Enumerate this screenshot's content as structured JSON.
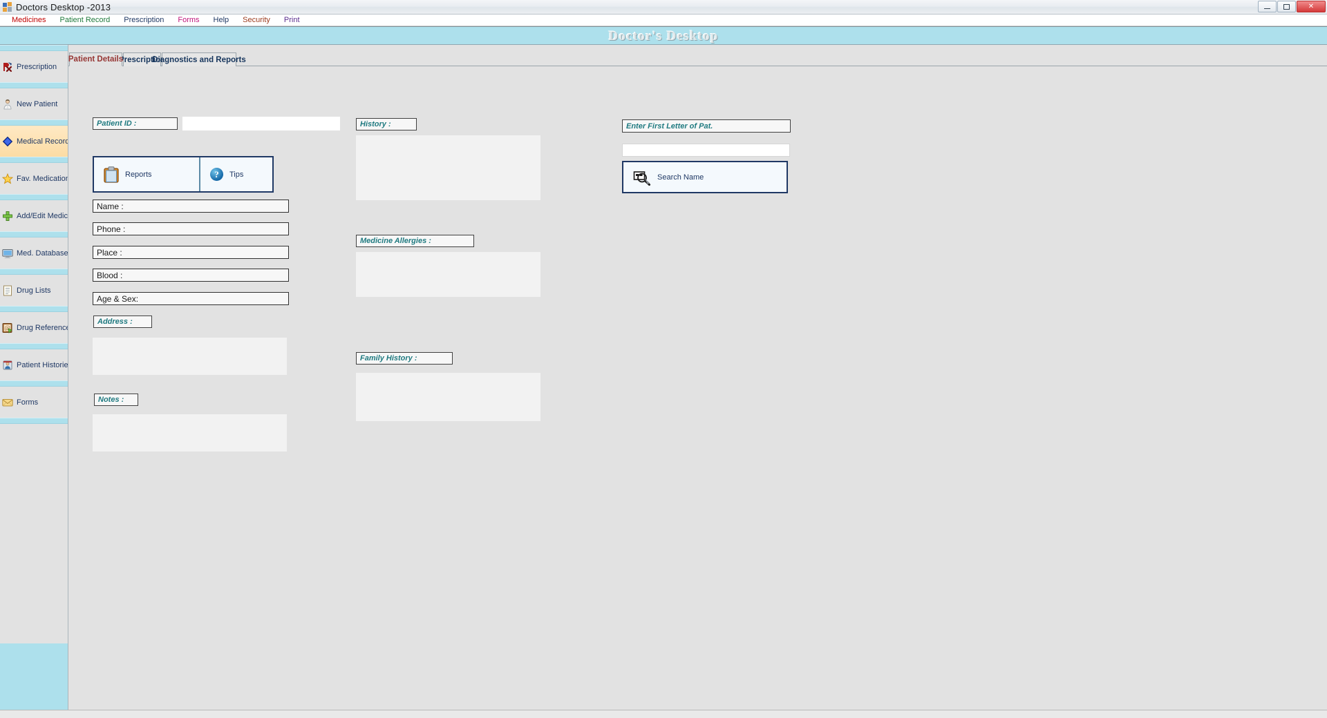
{
  "window": {
    "title": "Doctors Desktop -2013",
    "app_icon": "app-squares-icon",
    "minimize_label": "",
    "maximize_label": "",
    "close_label": "✕"
  },
  "menubar": {
    "items": [
      {
        "label": "Medicines",
        "color": "#c00000"
      },
      {
        "label": "Patient Record",
        "color": "#1f7a3c"
      },
      {
        "label": "Prescription",
        "color": "#1f3864"
      },
      {
        "label": "Forms",
        "color": "#c0157c"
      },
      {
        "label": "Help",
        "color": "#1f3864"
      },
      {
        "label": "Security",
        "color": "#9c3a1c"
      },
      {
        "label": "Print",
        "color": "#5b2d8e"
      }
    ]
  },
  "banner": {
    "title": "Doctor's Desktop",
    "background": "#ade0ec"
  },
  "sidebar": {
    "items": [
      {
        "label": "Prescription",
        "icon": "prescription-rx-icon",
        "active": false
      },
      {
        "label": "New Patient",
        "icon": "new-patient-icon",
        "active": false
      },
      {
        "label": "Medical Records",
        "icon": "medical-records-icon",
        "active": true
      },
      {
        "label": "Fav. Medication",
        "icon": "star-icon",
        "active": false
      },
      {
        "label": "Add/Edit Medicines",
        "icon": "plus-icon",
        "active": false
      },
      {
        "label": "Med. Database",
        "icon": "monitor-icon",
        "active": false
      },
      {
        "label": "Drug Lists",
        "icon": "list-icon",
        "active": false
      },
      {
        "label": "Drug Reference",
        "icon": "book-at-icon",
        "active": false
      },
      {
        "label": "Patient Histories",
        "icon": "histories-icon",
        "active": false
      },
      {
        "label": "Forms",
        "icon": "envelope-icon",
        "active": false
      }
    ],
    "highlight_color": "#fcdca4",
    "separator_color": "#ade0ec"
  },
  "tabs": [
    {
      "label": "Patient Details",
      "active": true
    },
    {
      "label": "Prescription",
      "active": false
    },
    {
      "label": "Diagnostics and Reports",
      "active": false
    }
  ],
  "left_column": {
    "patient_id_label": "Patient ID :",
    "patient_id_value": "",
    "reports_button": {
      "label": "Reports",
      "icon": "clipboard-icon"
    },
    "tips_button": {
      "label": "Tips",
      "icon": "question-circle-icon"
    },
    "fields": [
      {
        "label": "Name :",
        "value": ""
      },
      {
        "label": "Phone :",
        "value": ""
      },
      {
        "label": "Place :",
        "value": ""
      },
      {
        "label": "Blood :",
        "value": ""
      },
      {
        "label": "Age & Sex:",
        "value": ""
      }
    ],
    "address_label": "Address :",
    "address_value": "",
    "notes_label": "Notes :",
    "notes_value": ""
  },
  "middle_column": {
    "history_label": "History :",
    "history_value": "",
    "allergies_label": "Medicine Allergies :",
    "allergies_value": "",
    "family_history_label": "Family History :",
    "family_history_value": ""
  },
  "right_column": {
    "first_letter_label": "Enter First Letter of Pat.",
    "first_letter_value": "",
    "search_input_value": "",
    "search_button": {
      "label": "Search Name",
      "icon": "search-magnifier-icon"
    }
  }
}
